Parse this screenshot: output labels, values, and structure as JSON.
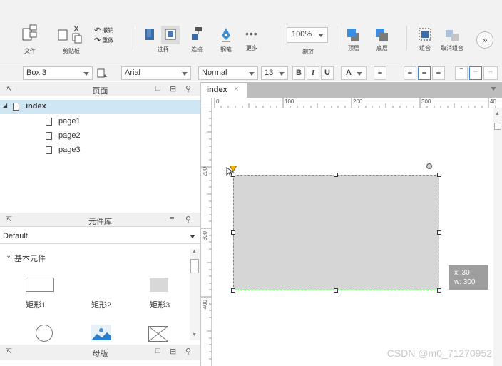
{
  "toolbar": {
    "file_label": "文件",
    "clipboard_label": "剪贴板",
    "undo_label": "撤销",
    "redo_label": "重做",
    "select_label": "选择",
    "connect_label": "连接",
    "pen_label": "钢笔",
    "more_label": "更多",
    "zoom_value": "100%",
    "zoom_label": "缩放",
    "top_label": "顶层",
    "bottom_label": "底层",
    "group_label": "组合",
    "ungroup_label": "取消组合"
  },
  "formatbar": {
    "object_select": "Box 3",
    "font_family": "Arial",
    "font_style": "Normal",
    "font_size": "13",
    "bold": "B",
    "italic": "I",
    "underline": "U",
    "font_color": "A"
  },
  "pages_panel": {
    "title": "页面",
    "root": "index",
    "pages": [
      "page1",
      "page2",
      "page3"
    ]
  },
  "widgets_panel": {
    "title": "元件库",
    "library": "Default",
    "category": "基本元件",
    "items": [
      "矩形1",
      "矩形2",
      "矩形3"
    ]
  },
  "masters_panel": {
    "title": "母版"
  },
  "canvas": {
    "tab_label": "index",
    "ruler_h": [
      "0",
      "100",
      "200",
      "300",
      "40"
    ],
    "ruler_v": [
      "200",
      "300",
      "400"
    ],
    "info_x": "x: 30",
    "info_w": "w: 300"
  },
  "watermark": "CSDN @m0_71270952"
}
